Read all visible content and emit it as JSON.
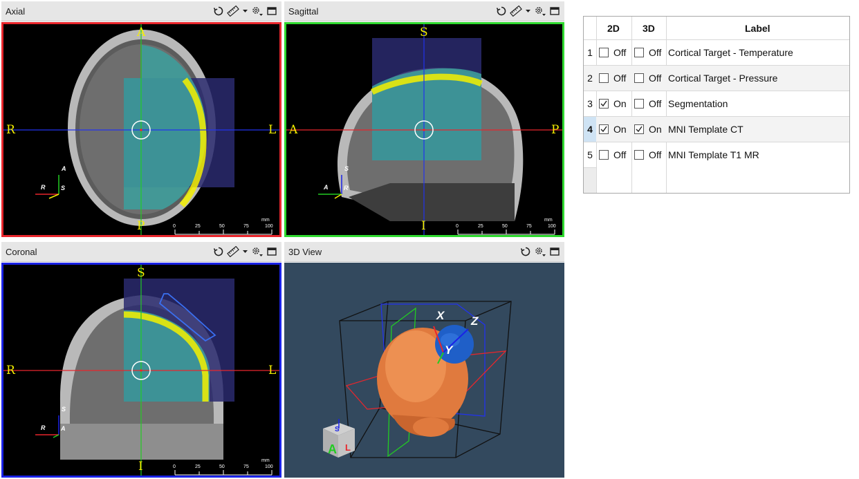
{
  "views": {
    "axial": {
      "title": "Axial",
      "top": "A",
      "bottom": "P",
      "left": "R",
      "right": "L",
      "border": "#e8262c",
      "ori_up": "A",
      "ori_left": "R",
      "ori_out": "S"
    },
    "sagittal": {
      "title": "Sagittal",
      "top": "S",
      "bottom": "I",
      "left": "A",
      "right": "P",
      "border": "#2fd92f",
      "ori_up": "S",
      "ori_left": "A",
      "ori_out": "R"
    },
    "coronal": {
      "title": "Coronal",
      "top": "S",
      "bottom": "I",
      "left": "R",
      "right": "L",
      "border": "#1a22e6",
      "ori_up": "S",
      "ori_left": "R",
      "ori_out": "A"
    },
    "threed": {
      "title": "3D View",
      "bg": "#33495e"
    }
  },
  "scale": {
    "unit": "mm",
    "ticks": [
      "0",
      "25",
      "50",
      "75",
      "100"
    ]
  },
  "axes3d": {
    "x": "X",
    "y": "Y",
    "z": "Z"
  },
  "cube_labels": {
    "front": "A",
    "side": "L",
    "top": "S"
  },
  "colors": {
    "accent_yellow": "#f5f000",
    "overlay_teal": "#3e9c9a",
    "overlay_navy": "#2a2a6e",
    "skull_orange": "#e07a3e",
    "selected_row": "#cfe3f4"
  },
  "table": {
    "headers": {
      "col2d": "2D",
      "col3d": "3D",
      "label": "Label"
    },
    "rows": [
      {
        "num": "1",
        "d2_checked": false,
        "d2": "Off",
        "d3_checked": false,
        "d3": "Off",
        "label": "Cortical Target - Temperature",
        "selected": false
      },
      {
        "num": "2",
        "d2_checked": false,
        "d2": "Off",
        "d3_checked": false,
        "d3": "Off",
        "label": "Cortical Target - Pressure",
        "selected": false
      },
      {
        "num": "3",
        "d2_checked": true,
        "d2": "On",
        "d3_checked": false,
        "d3": "Off",
        "label": "Segmentation",
        "selected": false
      },
      {
        "num": "4",
        "d2_checked": true,
        "d2": "On",
        "d3_checked": true,
        "d3": "On",
        "label": "MNI Template CT",
        "selected": true
      },
      {
        "num": "5",
        "d2_checked": false,
        "d2": "Off",
        "d3_checked": false,
        "d3": "Off",
        "label": "MNI Template T1 MR",
        "selected": false
      }
    ]
  }
}
